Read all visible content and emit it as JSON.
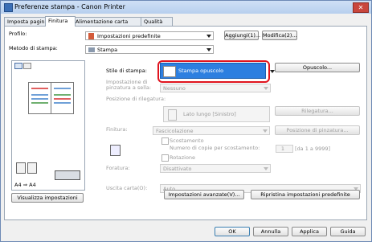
{
  "window": {
    "title": "Preferenze stampa - Canon Printer"
  },
  "tabs": [
    "Imposta pagina",
    "Finitura",
    "Alimentazione carta",
    "Qualità"
  ],
  "active_tab": "Finitura",
  "profile": {
    "label": "Profilo:",
    "value": "Impostazioni predefinite",
    "add_button": "Aggiungi(1)...",
    "edit_button": "Modifica(2)..."
  },
  "print_method": {
    "label": "Metodo di stampa:",
    "value": "Stampa"
  },
  "print_style": {
    "label": "Stile di stampa:",
    "value": "Stampa opuscolo",
    "booklet_button": "Opuscolo..."
  },
  "binding": {
    "label": "Impostazione di pinzatura a sella:",
    "value": "Nessuno"
  },
  "binding_position": {
    "label": "Posizione di rilegatura:",
    "value": "Lato lungo [Sinistro]",
    "button": "Rilegatura..."
  },
  "finishing": {
    "label": "Finitura:",
    "value": "Fascicolazione",
    "button": "Posizione di pinzatura...",
    "offset_label": "Scostamento",
    "copies_label": "Numero di copie per scostamento:",
    "copies_value": "1",
    "copies_hint": "[da 1 a 9999]",
    "rotate_label": "Rotazione"
  },
  "hole_punch": {
    "label": "Foratura:",
    "value": "Disattivato"
  },
  "output_tray": {
    "label": "Uscita carta(O):",
    "value": "Auto"
  },
  "preview": {
    "scale": "A4 ⇒ A4",
    "button": "Visualizza impostazioni"
  },
  "bottom": {
    "advanced": "Impostazioni avanzate(V)...",
    "restore": "Ripristina impostazioni predefinite"
  },
  "dialog": {
    "ok": "OK",
    "cancel": "Annulla",
    "apply": "Applica",
    "help": "Guida"
  }
}
